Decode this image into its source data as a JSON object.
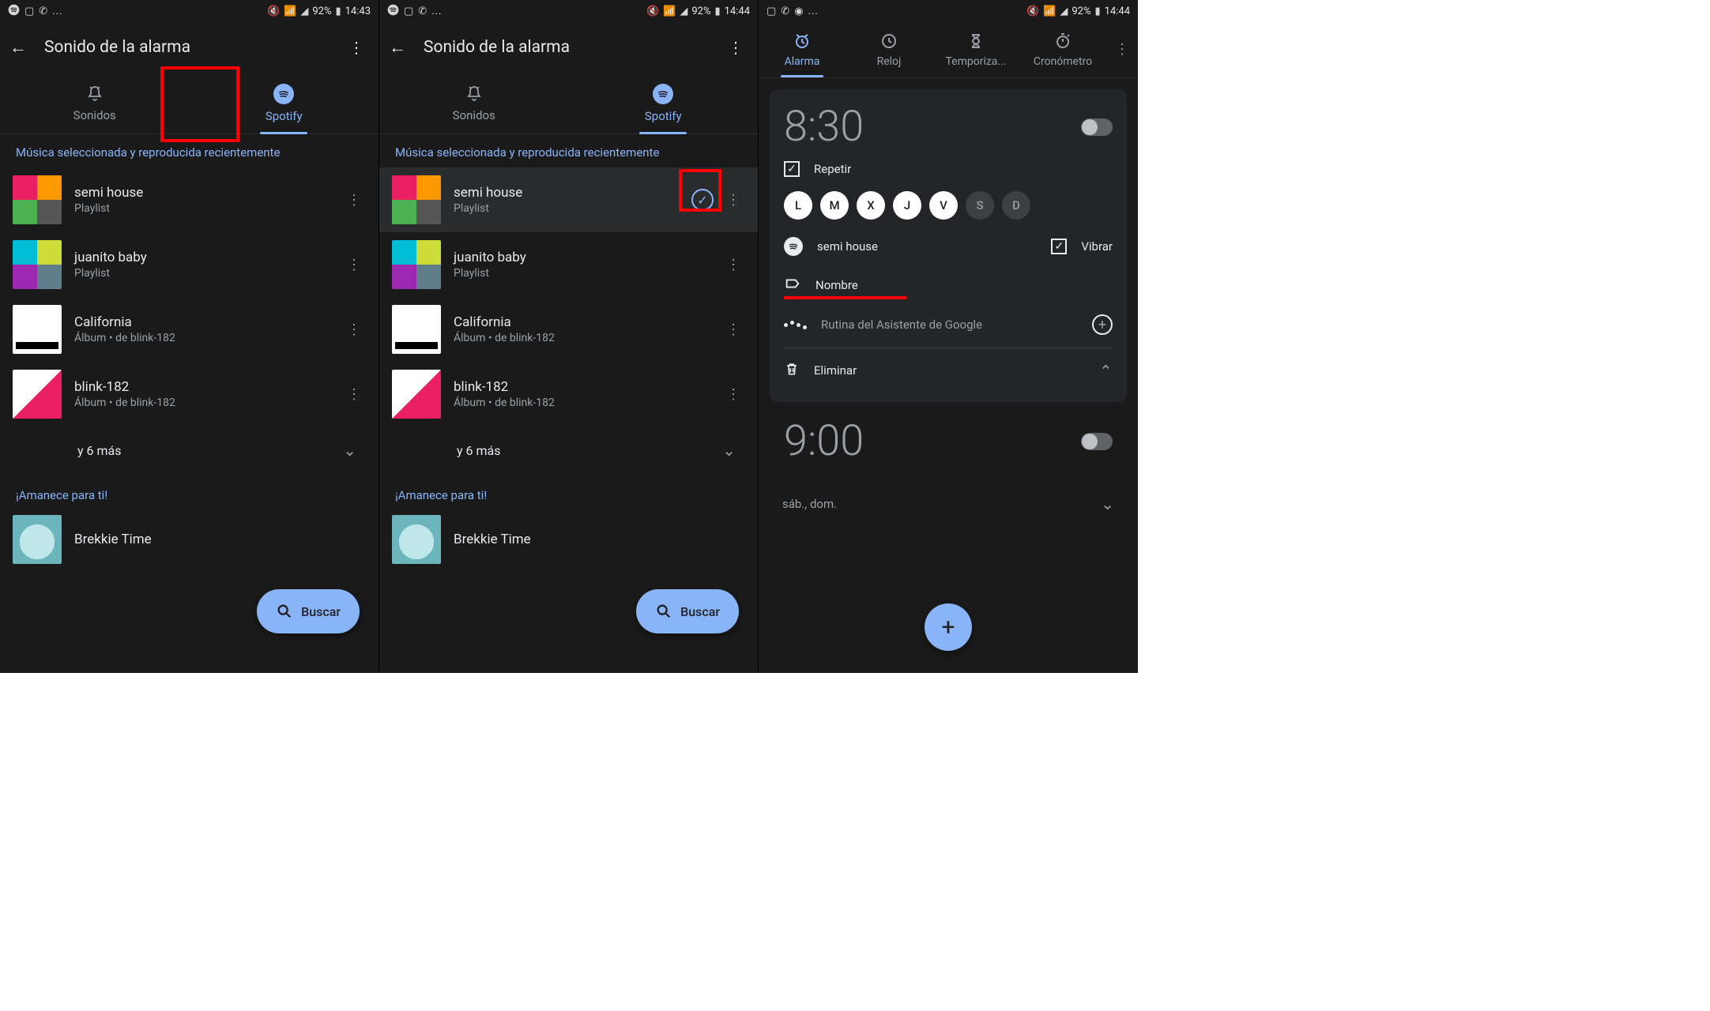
{
  "status": {
    "left_icons": [
      "spotify-icon",
      "image-icon",
      "whatsapp-icon"
    ],
    "battery_pct": "92%",
    "time1": "14:43",
    "time2": "14:44",
    "left_icons_clock": [
      "image-icon",
      "whatsapp-icon",
      "circle-icon"
    ]
  },
  "alarm_sound": {
    "title": "Sonido de la alarma",
    "tabs": {
      "sounds": "Sonidos",
      "spotify": "Spotify"
    },
    "section_recent": "Música seleccionada y reproducida recientemente",
    "tracks": [
      {
        "title": "semi house",
        "subtitle": "Playlist"
      },
      {
        "title": "juanito baby",
        "subtitle": "Playlist"
      },
      {
        "title": "California",
        "subtitle": "Álbum • de blink-182"
      },
      {
        "title": "blink-182",
        "subtitle": "Álbum • de blink-182"
      }
    ],
    "more": "y 6 más",
    "section_morning": "¡Amanece para ti!",
    "track_morning": {
      "title": "Brekkie Time"
    },
    "search_label": "Buscar"
  },
  "clock": {
    "tabs": {
      "alarm": "Alarma",
      "clock": "Reloj",
      "timer": "Temporiza...",
      "stopwatch": "Cronómetro"
    },
    "alarm1": {
      "time": "8:30",
      "repeat": "Repetir",
      "days": [
        "L",
        "M",
        "X",
        "J",
        "V",
        "S",
        "D"
      ],
      "days_on": [
        true,
        true,
        true,
        true,
        true,
        false,
        false
      ],
      "sound": "semi house",
      "vibrate": "Vibrar",
      "name": "Nombre",
      "assistant": "Rutina del Asistente de Google",
      "delete": "Eliminar"
    },
    "alarm2": {
      "time": "9:00",
      "summary": "sáb., dom."
    }
  }
}
